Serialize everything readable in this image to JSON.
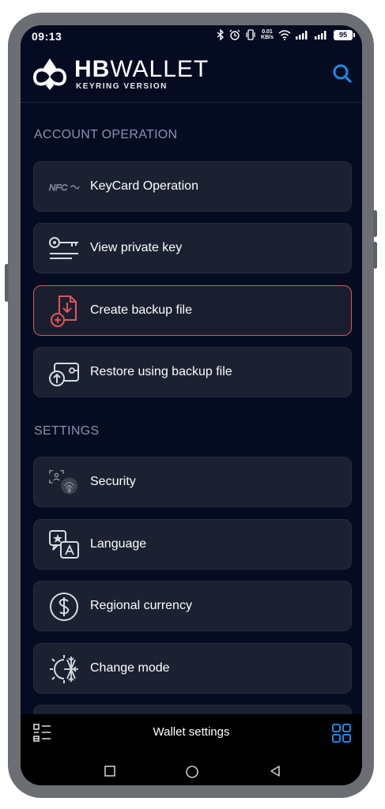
{
  "status": {
    "time": "09:13",
    "net_speed_value": "0.01",
    "net_speed_unit": "KB/s",
    "battery": "95"
  },
  "header": {
    "logo_bold": "HB",
    "logo_light": "WALLET",
    "logo_sub": "KEYRING VERSION"
  },
  "account_operation": {
    "title": "ACCOUNT OPERATION",
    "items": [
      {
        "label": "KeyCard Operation",
        "icon": "nfc-icon"
      },
      {
        "label": "View private key",
        "icon": "key-icon"
      },
      {
        "label": "Create backup file",
        "icon": "backup-file-icon"
      },
      {
        "label": "Restore using backup file",
        "icon": "restore-icon"
      }
    ]
  },
  "settings": {
    "title": "SETTINGS",
    "items": [
      {
        "label": "Security",
        "icon": "fingerprint-icon"
      },
      {
        "label": "Language",
        "icon": "language-icon"
      },
      {
        "label": "Regional currency",
        "icon": "dollar-icon"
      },
      {
        "label": "Change mode",
        "icon": "sun-snow-icon"
      }
    ]
  },
  "bottom_bar": {
    "title": "Wallet settings"
  },
  "nfc_text": "NFC",
  "colors": {
    "accent": "#1e88e5",
    "background": "#050c21",
    "card": "#1b2131",
    "active_border": "#e0555c"
  }
}
